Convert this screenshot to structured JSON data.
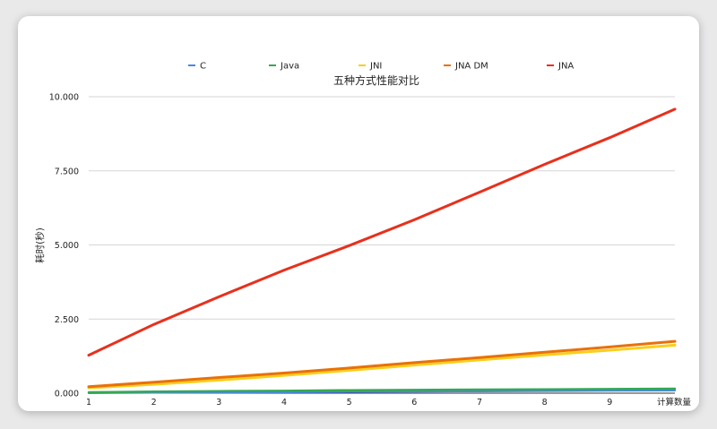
{
  "chart_data": {
    "type": "line",
    "title": "五种方式性能对比",
    "xlabel": "计算数量",
    "ylabel": "耗时(秒)",
    "x": [
      1,
      2,
      3,
      4,
      5,
      6,
      7,
      8,
      9,
      10
    ],
    "x_tick_labels": [
      "1",
      "2",
      "3",
      "4",
      "5",
      "6",
      "7",
      "8",
      "9"
    ],
    "ylim": [
      0,
      10
    ],
    "y_ticks": [
      0,
      2.5,
      5,
      7.5,
      10
    ],
    "y_tick_labels": [
      "0.000",
      "2.500",
      "5.000",
      "7.500",
      "10.000"
    ],
    "grid": true,
    "legend_position": "top",
    "series": [
      {
        "name": "C",
        "color": "#4a86e8",
        "values": [
          0.01,
          0.02,
          0.03,
          0.04,
          0.05,
          0.06,
          0.07,
          0.08,
          0.09,
          0.1
        ]
      },
      {
        "name": "Java",
        "color": "#34a853",
        "values": [
          0.03,
          0.05,
          0.07,
          0.08,
          0.1,
          0.11,
          0.12,
          0.13,
          0.14,
          0.15
        ]
      },
      {
        "name": "JNI",
        "color": "#fbce1b",
        "values": [
          0.18,
          0.3,
          0.44,
          0.6,
          0.77,
          0.95,
          1.12,
          1.29,
          1.45,
          1.62
        ]
      },
      {
        "name": "JNA DM",
        "color": "#e8710a",
        "values": [
          0.22,
          0.37,
          0.53,
          0.68,
          0.85,
          1.03,
          1.2,
          1.38,
          1.56,
          1.75
        ]
      },
      {
        "name": "JNA",
        "color": "#e8301c",
        "values": [
          1.28,
          2.32,
          3.25,
          4.15,
          4.98,
          5.85,
          6.78,
          7.72,
          8.62,
          9.58
        ]
      }
    ]
  }
}
